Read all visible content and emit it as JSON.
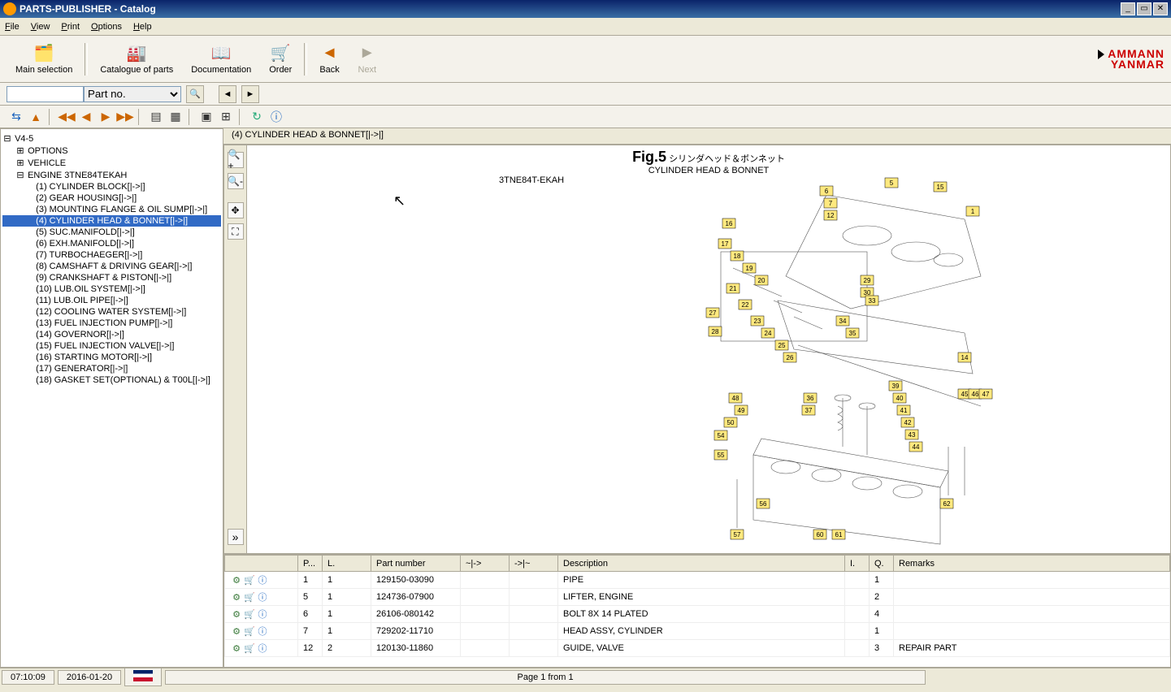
{
  "window": {
    "title": "PARTS-PUBLISHER - Catalog"
  },
  "menu": {
    "file": "File",
    "view": "View",
    "print": "Print",
    "options": "Options",
    "help": "Help"
  },
  "toolbar": {
    "main_selection": "Main selection",
    "catalogue_of_parts": "Catalogue of parts",
    "documentation": "Documentation",
    "order": "Order",
    "back": "Back",
    "next": "Next"
  },
  "brand": {
    "line1": "AMMANN",
    "line2": "YANMAR"
  },
  "search": {
    "field_value": "",
    "type_label": "Part no."
  },
  "tree": {
    "root": "V4-5",
    "options": "OPTIONS",
    "vehicle": "VEHICLE",
    "engine": "ENGINE 3TNE84TEKAH",
    "items": [
      "(1) CYLINDER BLOCK[|->|]",
      "(2) GEAR HOUSING[|->|]",
      "(3) MOUNTING FLANGE & OIL SUMP[|->|]",
      "(4) CYLINDER HEAD & BONNET[|->|]",
      "(5) SUC.MANIFOLD[|->|]",
      "(6) EXH.MANIFOLD[|->|]",
      "(7) TURBOCHAEGER[|->|]",
      "(8) CAMSHAFT & DRIVING GEAR[|->|]",
      "(9) CRANKSHAFT & PISTON[|->|]",
      "(10) LUB.OIL SYSTEM[|->|]",
      "(11) LUB.OIL PIPE[|->|]",
      "(12) COOLING WATER SYSTEM[|->|]",
      "(13) FUEL INJECTION PUMP[|->|]",
      "(14) GOVERNOR[|->|]",
      "(15) FUEL INJECTION VALVE[|->|]",
      "(16) STARTING MOTOR[|->|]",
      "(17) GENERATOR[|->|]",
      "(18) GASKET SET(OPTIONAL) & T00L[|->|]"
    ],
    "selected_index": 3
  },
  "breadcrumb": "(4) CYLINDER HEAD & BONNET[|->|]",
  "figure": {
    "fig_no": "Fig.5",
    "jp": "シリンダヘッド＆ボンネット",
    "en": "CYLINDER HEAD & BONNET",
    "model": "3TNE84T-EKAH"
  },
  "table": {
    "headers": {
      "pos": "P...",
      "lvl": "L.",
      "partno": "Part number",
      "arr1": "~|->",
      "arr2": "->|~",
      "desc": "Description",
      "i": "I.",
      "q": "Q.",
      "remarks": "Remarks"
    },
    "rows": [
      {
        "pos": "1",
        "lvl": "1",
        "partno": "129150-03090",
        "desc": "PIPE",
        "q": "1",
        "remarks": ""
      },
      {
        "pos": "5",
        "lvl": "1",
        "partno": "124736-07900",
        "desc": "LIFTER, ENGINE",
        "q": "2",
        "remarks": ""
      },
      {
        "pos": "6",
        "lvl": "1",
        "partno": "26106-080142",
        "desc": "BOLT 8X 14 PLATED",
        "q": "4",
        "remarks": ""
      },
      {
        "pos": "7",
        "lvl": "1",
        "partno": "729202-11710",
        "desc": "HEAD ASSY, CYLINDER",
        "q": "1",
        "remarks": ""
      },
      {
        "pos": "12",
        "lvl": "2",
        "partno": "120130-11860",
        "desc": "GUIDE, VALVE",
        "q": "3",
        "remarks": "REPAIR PART"
      }
    ]
  },
  "status": {
    "time": "07:10:09",
    "date": "2016-01-20",
    "page": "Page 1 from 1"
  },
  "callouts": [
    1,
    5,
    6,
    7,
    12,
    14,
    15,
    16,
    17,
    18,
    19,
    20,
    21,
    22,
    23,
    24,
    25,
    26,
    27,
    28,
    29,
    30,
    33,
    34,
    35,
    36,
    37,
    39,
    40,
    41,
    42,
    43,
    44,
    45,
    46,
    47,
    48,
    49,
    50,
    54,
    55,
    56,
    57,
    60,
    61,
    62
  ]
}
